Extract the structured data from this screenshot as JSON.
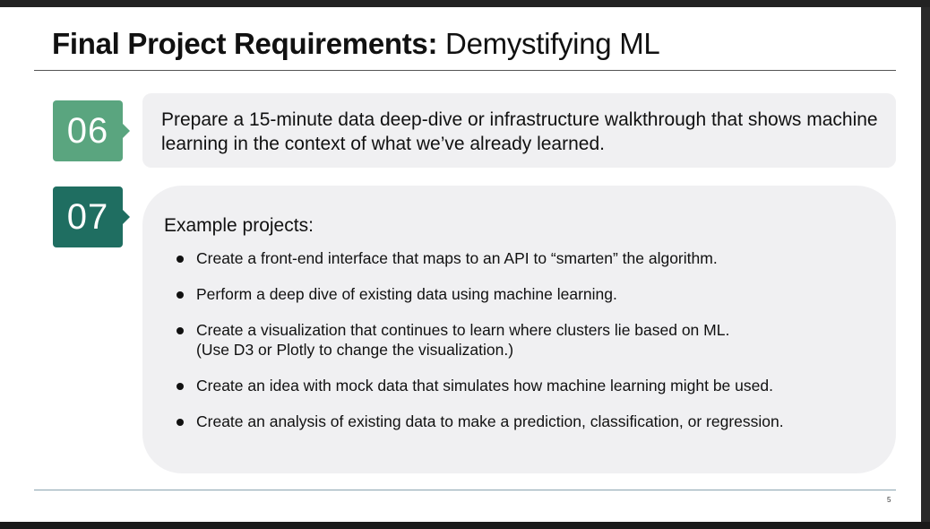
{
  "slide": {
    "title_bold": "Final Project Requirements:",
    "title_light": " Demystifying ML",
    "page_number": "5"
  },
  "items": [
    {
      "number": "06",
      "text": "Prepare a 15-minute data deep-dive or infrastructure walkthrough that shows machine learning in the context of what we’ve already learned."
    },
    {
      "number": "07",
      "heading": "Example projects:",
      "bullets": [
        {
          "line1": "Create a front-end interface that maps to an API to “smarten” the algorithm."
        },
        {
          "line1": "Perform a deep dive of existing data using machine learning."
        },
        {
          "line1": "Create a visualization that continues to learn where clusters lie based on ML.",
          "line2": "(Use D3 or Plotly to change the visualization.)"
        },
        {
          "line1": "Create an idea with mock data that simulates how machine learning might be used."
        },
        {
          "line1": "Create an analysis of existing data to make a prediction, classification, or regression."
        }
      ]
    }
  ],
  "colors": {
    "badge_06": "#5aa57f",
    "badge_07": "#1f6e61",
    "card_bg": "#f0f0f2"
  }
}
